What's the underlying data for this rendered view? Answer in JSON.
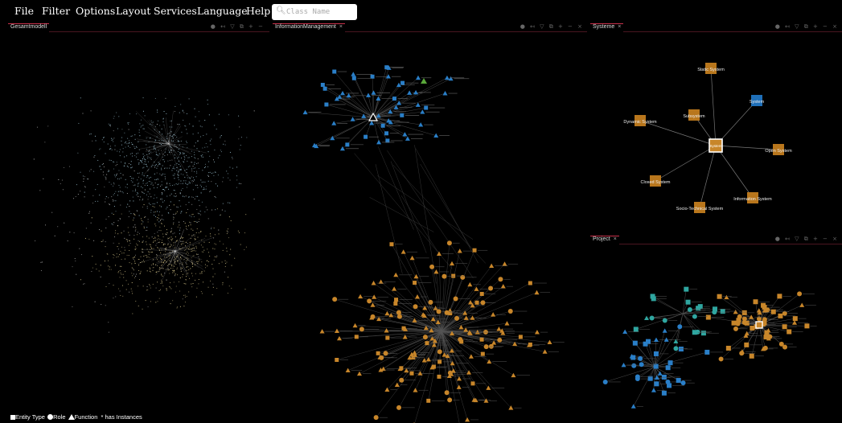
{
  "menu": {
    "items": [
      "File",
      "Filter",
      "Options",
      "Layout",
      "Services",
      "Language",
      "Help"
    ]
  },
  "search": {
    "placeholder": "Class Name"
  },
  "panels": {
    "gesamt": {
      "title": "Gesamtmodell",
      "tools": "● ↤ ▽ ⧉ + −"
    },
    "info": {
      "title": "InformationManagement",
      "tools": "● ↤ ▽ ⧉ + − ×"
    },
    "systeme": {
      "title": "Systeme",
      "tools": "● ↤ ▽ ⧉ + − ×",
      "center_label": "System",
      "nodes": [
        {
          "label": "Static System",
          "color": "#b8761c"
        },
        {
          "label": "System",
          "color": "#1f6fb8"
        },
        {
          "label": "Open System",
          "color": "#b8761c"
        },
        {
          "label": "Information System",
          "color": "#b8761c"
        },
        {
          "label": "Socio-Technical System",
          "color": "#b8761c"
        },
        {
          "label": "Closed System",
          "color": "#b8761c"
        },
        {
          "label": "Dynamic System",
          "color": "#b8761c"
        },
        {
          "label": "Subsystem",
          "color": "#b8761c"
        }
      ]
    },
    "project": {
      "title": "Project",
      "tools": "● ↤ ▽ ⧉ + − ×"
    }
  },
  "legend": {
    "entity": "Entity Type",
    "role": "Role",
    "function": "Function",
    "instances": "* has Instances"
  },
  "colors": {
    "orange": "#c8862a",
    "blue": "#2a7fc8",
    "teal": "#2fa6a0",
    "green": "#5aa83a",
    "edge": "#555555",
    "tab_accent": "#c8304a"
  }
}
